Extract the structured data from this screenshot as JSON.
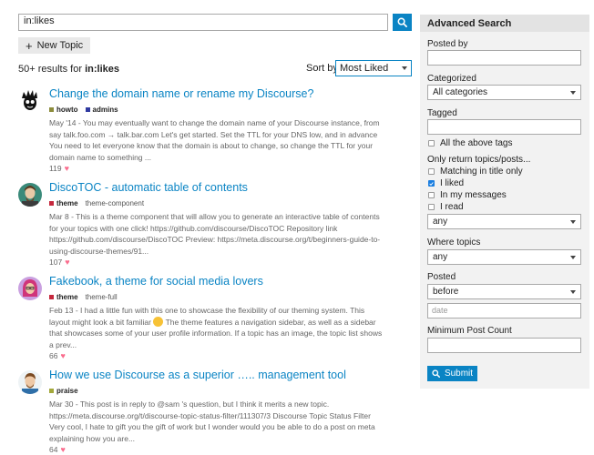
{
  "search": {
    "query": "in:likes"
  },
  "toolbar": {
    "new_topic_label": "New Topic"
  },
  "results_header": {
    "count_prefix": "50+ results for",
    "count_query": "in:likes",
    "sort_label": "Sort by",
    "sort_value": "Most Liked"
  },
  "results": [
    {
      "title": "Change the domain name or rename my Discourse?",
      "tags": [
        {
          "name": "howto",
          "color": "#8c8c3c"
        },
        {
          "name": "admins",
          "color": "#2f3aa0"
        }
      ],
      "blurb": "May '14 - You may eventually want to change the domain name of your Discourse instance, from say talk.foo.com → talk.bar.com Let's get started. Set the TTL for your DNS low, and in advance You need to let everyone know that the domain is about to change, so change the TTL for your domain name to something ...",
      "likes": "119"
    },
    {
      "title": "DiscoTOC - automatic table of contents",
      "tags": [
        {
          "name": "theme",
          "color": "#c5283d"
        }
      ],
      "plain_tag": "theme-component",
      "blurb": "Mar 8 - This is a theme component that will allow you to generate an interactive table of contents for your topics with one click! https://github.com/discourse/DiscoTOC Repository link https://github.com/discourse/DiscoTOC Preview: https://meta.discourse.org/t/beginners-guide-to-using-discourse-themes/91...",
      "likes": "107"
    },
    {
      "title": "Fakebook, a theme for social media lovers",
      "tags": [
        {
          "name": "theme",
          "color": "#c5283d"
        }
      ],
      "plain_tag": "theme-full",
      "blurb_before_emoji": "Feb 13 - I had a little fun with this one to showcase the flexibility of our theming system. This layout might look a bit familiar",
      "blurb_after_emoji": "The theme features a navigation sidebar, as well as a sidebar that showcases some of your user profile information. If a topic has an image, the topic list shows a prev...",
      "likes": "66"
    },
    {
      "title": "How we use Discourse as a superior ….. management tool",
      "tags": [
        {
          "name": "praise",
          "color": "#a3a83a"
        }
      ],
      "blurb": "Mar 30 - This post is in reply to @sam 's question, but I think it merits a new topic. https://meta.discourse.org/t/discourse-topic-status-filter/111307/3 Discourse Topic Status Filter Very cool, I hate to gift you the gift of work but I wonder would you be able to do a post on meta explaining how you are...",
      "likes": "64"
    }
  ],
  "sidebar": {
    "title": "Advanced Search",
    "posted_by_label": "Posted by",
    "categorized_label": "Categorized",
    "categorized_value": "All categories",
    "tagged_label": "Tagged",
    "all_tags_label": "All the above tags",
    "only_return_label": "Only return topics/posts...",
    "options": [
      {
        "label": "Matching in title only",
        "checked": false
      },
      {
        "label": "I liked",
        "checked": true
      },
      {
        "label": "In my messages",
        "checked": false
      },
      {
        "label": "I read",
        "checked": false
      }
    ],
    "status_value": "any",
    "where_topics_label": "Where topics",
    "where_topics_value": "any",
    "posted_label": "Posted",
    "posted_value": "before",
    "date_placeholder": "date",
    "min_post_label": "Minimum Post Count",
    "submit_label": "Submit"
  },
  "colors": {
    "accent": "#0a84c4",
    "heart": "#fa6c8d",
    "checkbox": "#1a7ee0"
  }
}
